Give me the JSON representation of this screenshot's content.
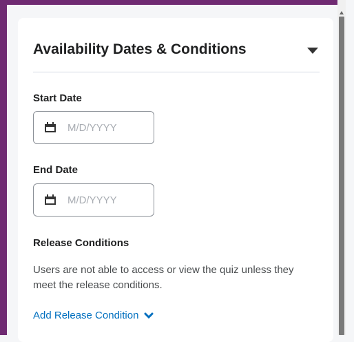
{
  "panel": {
    "title": "Availability Dates & Conditions",
    "start_date": {
      "label": "Start Date",
      "placeholder": "M/D/YYYY"
    },
    "end_date": {
      "label": "End Date",
      "placeholder": "M/D/YYYY"
    },
    "release_conditions": {
      "title": "Release Conditions",
      "description": "Users are not able to access or view the quiz unless they meet the release conditions.",
      "add_label": "Add Release Condition"
    }
  },
  "colors": {
    "frame": "#6f2a72",
    "link": "#006fbf"
  },
  "icons": {
    "collapse": "caret-down-icon",
    "date": "calendar-icon",
    "menu": "chevron-down-icon"
  }
}
